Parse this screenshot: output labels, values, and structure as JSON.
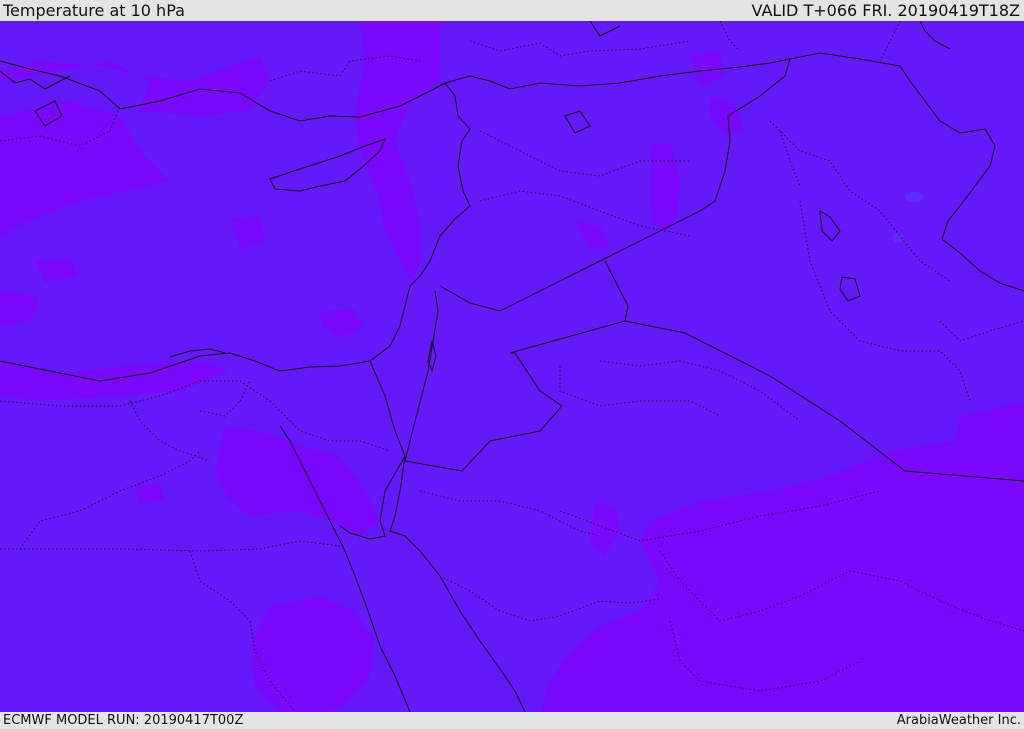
{
  "header": {
    "title": "Temperature at 10 hPa",
    "valid": "VALID T+066 FRI. 20190419T18Z"
  },
  "footer": {
    "model_run": "ECMWF MODEL RUN: 20190417T00Z",
    "credit": "ArabiaWeather Inc."
  },
  "colors": {
    "field_base": "#6519fb",
    "field_warm": "#7a08fc",
    "field_cold": "#5b2efb",
    "border_line": "#111111",
    "banner": "#e4e4e4"
  }
}
